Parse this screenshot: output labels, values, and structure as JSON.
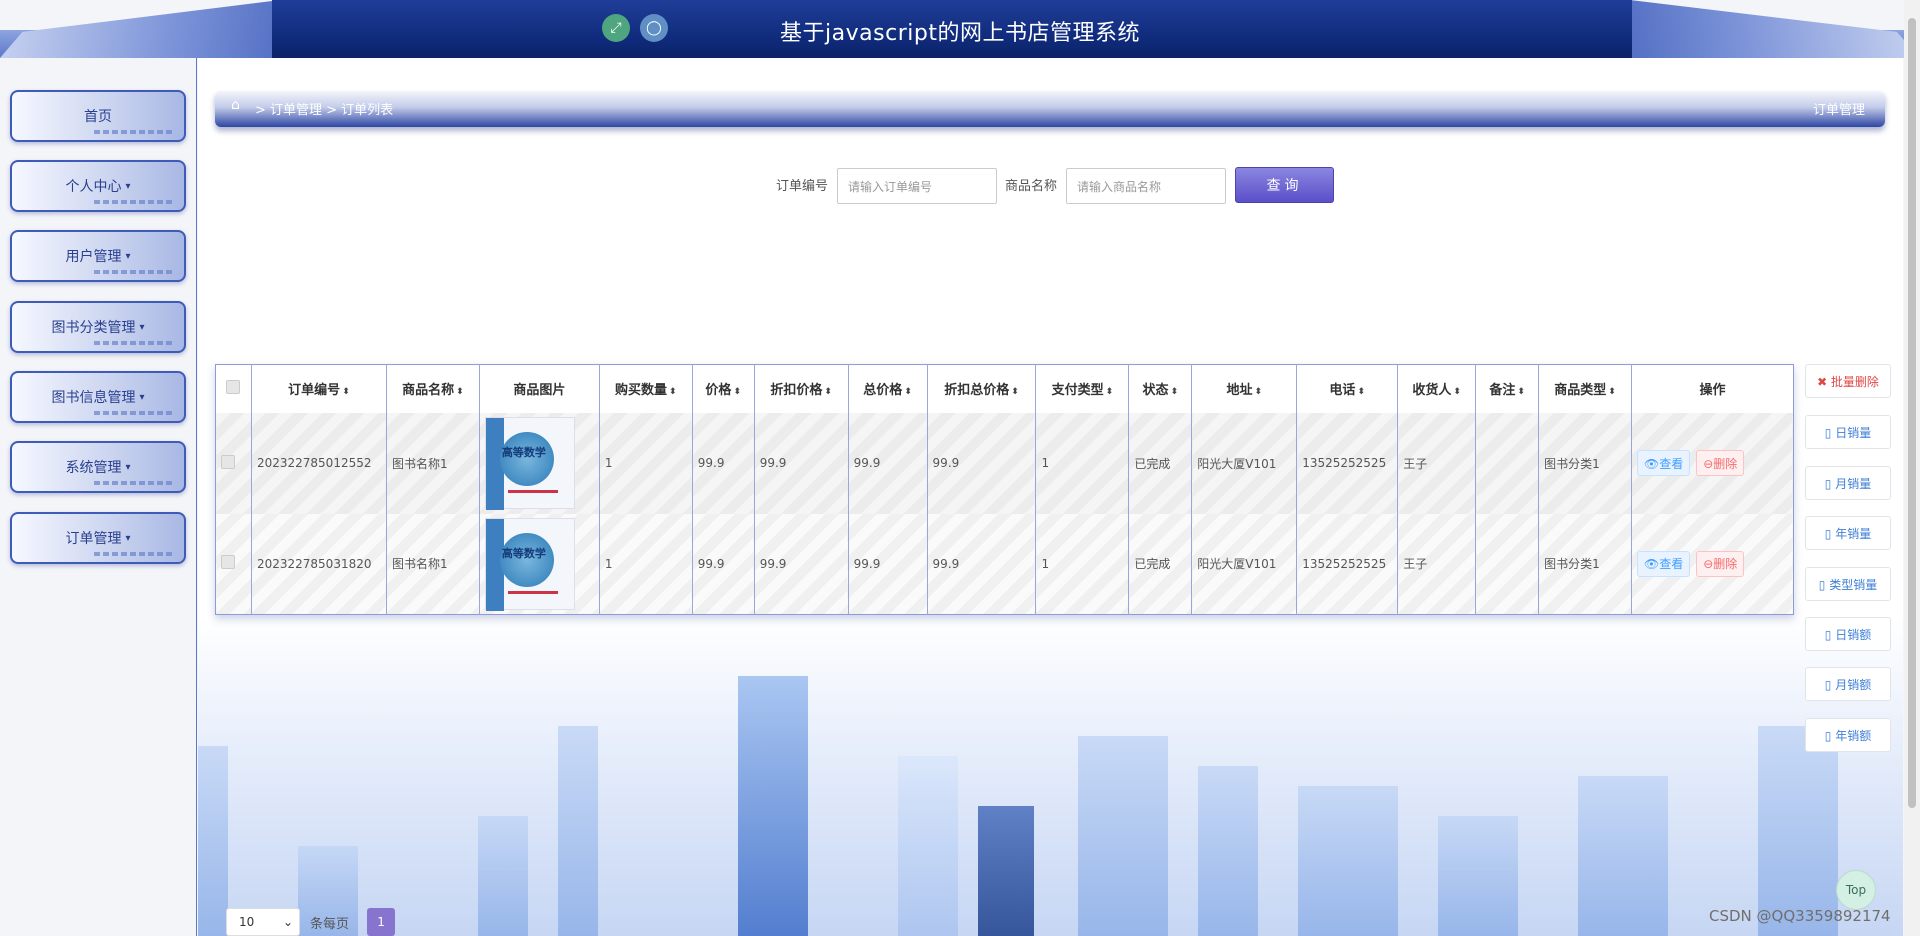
{
  "header": {
    "title": "基于javascript的网上书店管理系统",
    "fullscreen_icon": "⤢",
    "user_icon": "◯"
  },
  "sidebar": {
    "items": [
      {
        "label": "首页",
        "caret": ""
      },
      {
        "label": "个人中心",
        "caret": "▾"
      },
      {
        "label": "用户管理",
        "caret": "▾"
      },
      {
        "label": "图书分类管理",
        "caret": "▾"
      },
      {
        "label": "图书信息管理",
        "caret": "▾"
      },
      {
        "label": "系统管理",
        "caret": "▾"
      },
      {
        "label": "订单管理",
        "caret": "▾"
      }
    ]
  },
  "breadcrumb": {
    "home_icon": "⌂",
    "path": "> 订单管理 > 订单列表",
    "right": "订单管理"
  },
  "search": {
    "order_label": "订单编号",
    "order_placeholder": "请输入订单编号",
    "product_label": "商品名称",
    "product_placeholder": "请输入商品名称",
    "button": "查询"
  },
  "table": {
    "headers": [
      "订单编号",
      "商品名称",
      "商品图片",
      "购买数量",
      "价格",
      "折扣价格",
      "总价格",
      "折扣总价格",
      "支付类型",
      "状态",
      "地址",
      "电话",
      "收货人",
      "备注",
      "商品类型",
      "操作"
    ],
    "sort_icon": "⬍",
    "cover_title": "高等数学",
    "rows": [
      {
        "order_no": "202322785012552",
        "name": "图书名称1",
        "qty": "1",
        "price": "99.9",
        "disc_price": "99.9",
        "total": "99.9",
        "disc_total": "99.9",
        "pay_type": "1",
        "status": "已完成",
        "address": "阳光大厦V101",
        "phone": "13525252525",
        "receiver": "王子",
        "remark": "",
        "category": "图书分类1"
      },
      {
        "order_no": "202322785031820",
        "name": "图书名称1",
        "qty": "1",
        "price": "99.9",
        "disc_price": "99.9",
        "total": "99.9",
        "disc_total": "99.9",
        "pay_type": "1",
        "status": "已完成",
        "address": "阳光大厦V101",
        "phone": "13525252525",
        "receiver": "王子",
        "remark": "",
        "category": "图书分类1"
      }
    ],
    "view_label": "👁查看",
    "delete_label": "⊖删除"
  },
  "right_buttons": [
    "✖ 批量删除",
    "▯ 日销量",
    "▯ 月销量",
    "▯ 年销量",
    "▯ 类型销量",
    "▯ 日销额",
    "▯ 月销额",
    "▯ 年销额"
  ],
  "pager": {
    "page_size": "10",
    "caret": "⌄",
    "per_page_label": "条每页",
    "current_page": "1"
  },
  "top_button": "Top",
  "watermark": "CSDN @QQ3359892174"
}
